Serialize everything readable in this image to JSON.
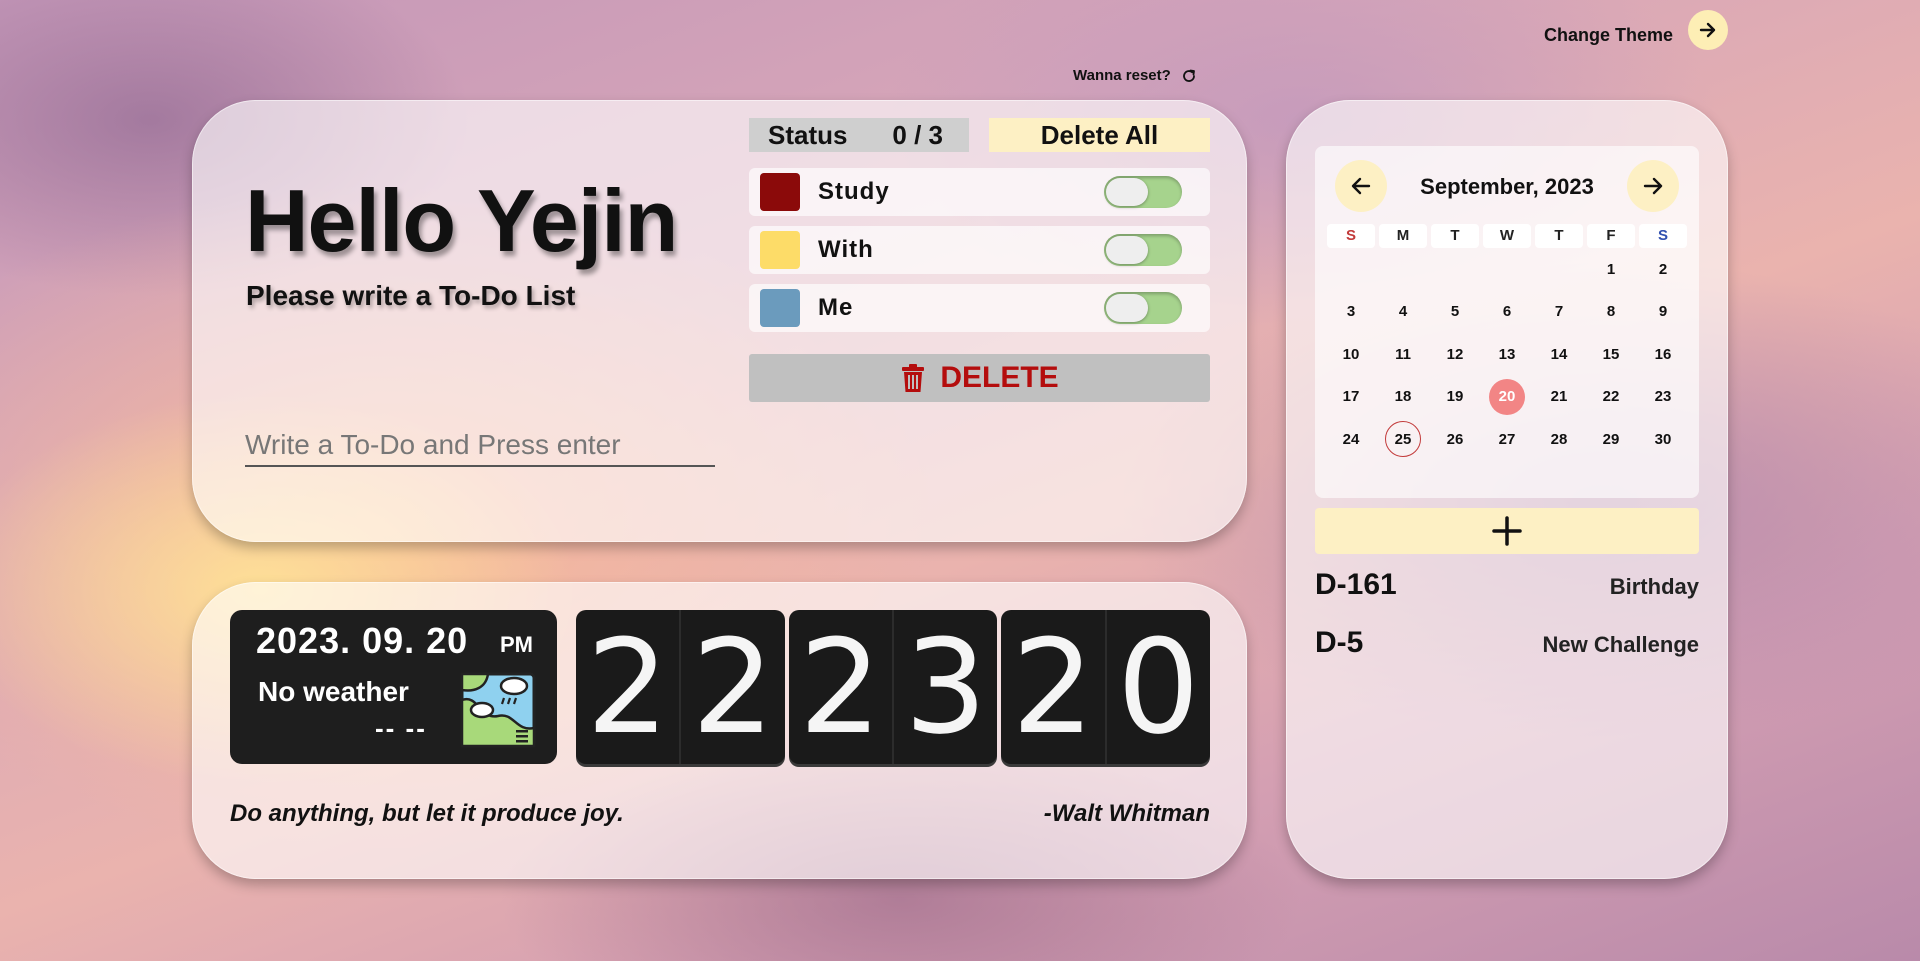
{
  "top_bar": {
    "change_theme_label": "Change Theme",
    "reset_label": "Wanna reset?"
  },
  "todo": {
    "greeting": "Hello Yejin",
    "subtitle": "Please write a To-Do List",
    "input_placeholder": "Write a To-Do and Press enter",
    "status_label": "Status",
    "status_value": "0 / 3",
    "delete_all_label": "Delete All",
    "tasks": [
      {
        "label": "Study",
        "color": "#8b0a0a",
        "done": false
      },
      {
        "label": "With",
        "color": "#fddc68",
        "done": false
      },
      {
        "label": "Me",
        "color": "#6b9bbd",
        "done": false
      }
    ],
    "delete_label": "DELETE",
    "delete_color": "#b40d0d"
  },
  "clock": {
    "date": "2023. 09. 20",
    "ampm": "PM",
    "weather": "No weather",
    "temperature": "-- --",
    "weather_icon": "map-weather-icon",
    "digits": [
      "2",
      "2",
      "2",
      "3",
      "2",
      "0"
    ]
  },
  "quote": {
    "text": "Do anything, but let it produce joy.",
    "author": "-Walt Whitman"
  },
  "calendar": {
    "title": "September, 2023",
    "weekdays": [
      {
        "label": "S",
        "color": "#c23a3a"
      },
      {
        "label": "M",
        "color": "#222222"
      },
      {
        "label": "T",
        "color": "#222222"
      },
      {
        "label": "W",
        "color": "#222222"
      },
      {
        "label": "T",
        "color": "#222222"
      },
      {
        "label": "F",
        "color": "#222222"
      },
      {
        "label": "S",
        "color": "#3050b0"
      }
    ],
    "leading_blanks": 5,
    "days": [
      "1",
      "2",
      "3",
      "4",
      "5",
      "6",
      "7",
      "8",
      "9",
      "10",
      "11",
      "12",
      "13",
      "14",
      "15",
      "16",
      "17",
      "18",
      "19",
      "20",
      "21",
      "22",
      "23",
      "24",
      "25",
      "26",
      "27",
      "28",
      "29",
      "30"
    ],
    "today": "20",
    "marked": "25",
    "today_color": "#f28585"
  },
  "ddays": [
    {
      "count": "D-161",
      "name": "Birthday"
    },
    {
      "count": "D-5",
      "name": "New Challenge"
    }
  ]
}
